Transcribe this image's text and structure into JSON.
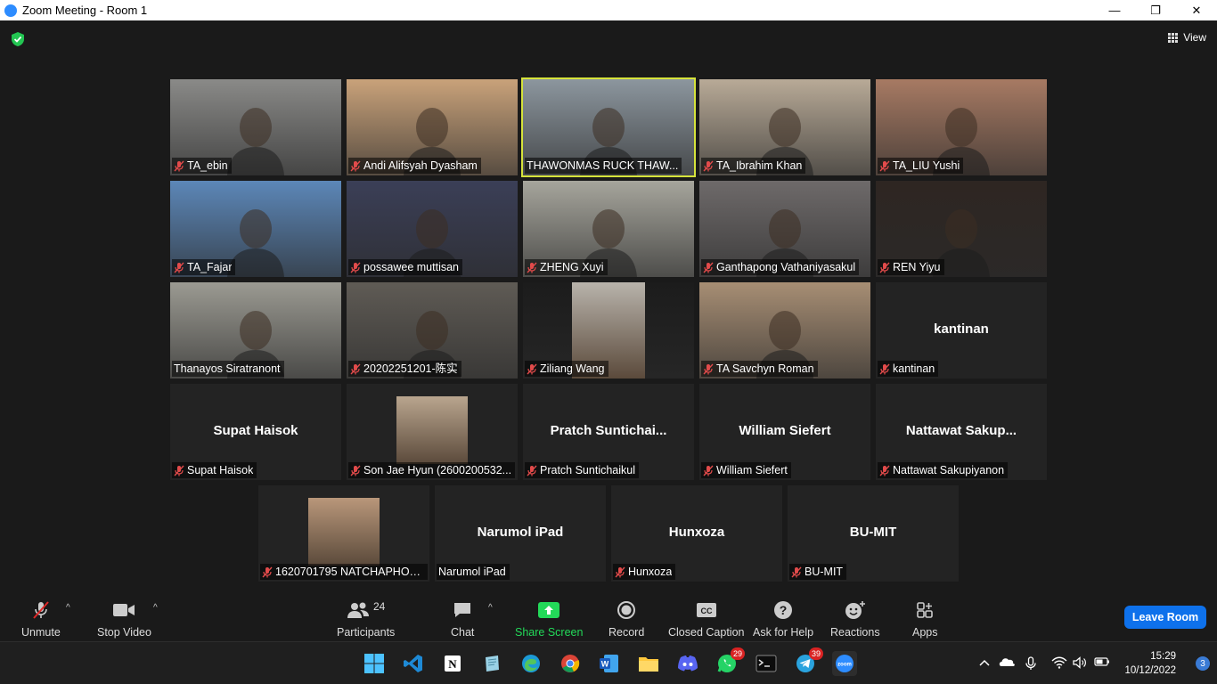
{
  "window": {
    "title": "Zoom Meeting - Room 1",
    "minimize": "—",
    "maximize": "❐",
    "close": "✕"
  },
  "topbar": {
    "view_label": "View"
  },
  "tiles": [
    {
      "name": "TA_ebin",
      "muted": true,
      "bg": "#8a8a88"
    },
    {
      "name": "Andi Alifsyah Dyasham",
      "muted": true,
      "bg": "#c9a27a"
    },
    {
      "name": "THAWONMAS RUCK THAW...",
      "muted": false,
      "bg": "#8c969e",
      "active": true
    },
    {
      "name": "TA_Ibrahim Khan",
      "muted": true,
      "bg": "#b8aa97"
    },
    {
      "name": "TA_LIU Yushi",
      "muted": true,
      "bg": "#a77a63"
    },
    {
      "name": "TA_Fajar",
      "muted": true,
      "bg": "#5c87b8"
    },
    {
      "name": "possawee muttisan",
      "muted": true,
      "bg": "#3b3f57"
    },
    {
      "name": "ZHENG Xuyi",
      "muted": true,
      "bg": "#a6a59c"
    },
    {
      "name": "Ganthapong Vathaniyasakul",
      "muted": true,
      "bg": "#6e6a6a"
    },
    {
      "name": "REN Yiyu",
      "muted": true,
      "bg": "#2e2622"
    },
    {
      "name": "Thanayos Siratranont",
      "muted": false,
      "bg": "#9b9a92"
    },
    {
      "name": "20202251201-陈实",
      "muted": true,
      "bg": "#5f5b55"
    },
    {
      "name": "Ziliang Wang",
      "muted": true,
      "bg": "#1c1c1c",
      "inset": "#b8b3ab"
    },
    {
      "name": "TA Savchyn Roman",
      "muted": true,
      "bg": "#a78e74"
    },
    {
      "name": "kantinan",
      "muted": true,
      "big": "kantinan"
    },
    {
      "name": "Supat Haisok",
      "muted": true,
      "big": "Supat Haisok"
    },
    {
      "name": "Son Jae Hyun (2600200532...",
      "muted": true,
      "inset": "#b9a58e"
    },
    {
      "name": "Pratch Suntichaikul",
      "muted": true,
      "big": "Pratch  Suntichai..."
    },
    {
      "name": "William Siefert",
      "muted": true,
      "big": "William Siefert"
    },
    {
      "name": "Nattawat Sakupiyanon",
      "muted": true,
      "big": "Nattawat  Sakup..."
    },
    {
      "name": "1620701795 NATCHAPHON...",
      "muted": true,
      "inset": "#b9977a"
    },
    {
      "name": "Narumol iPad",
      "muted": false,
      "big": "Narumol iPad"
    },
    {
      "name": "Hunxoza",
      "muted": true,
      "big": "Hunxoza"
    },
    {
      "name": "BU-MIT",
      "muted": true,
      "big": "BU-MIT"
    }
  ],
  "toolbar": {
    "unmute": "Unmute",
    "stop_video": "Stop Video",
    "participants": "Participants",
    "participants_count": "24",
    "chat": "Chat",
    "share_screen": "Share Screen",
    "record": "Record",
    "closed_caption": "Closed Caption",
    "ask_for_help": "Ask for Help",
    "reactions": "Reactions",
    "apps": "Apps",
    "leave_room": "Leave Room",
    "share_color": "#23d959",
    "leave_color": "#0e71eb"
  },
  "taskbar": {
    "whatsapp_badge": "29",
    "telegram_badge": "39",
    "time": "15:29",
    "date": "10/12/2022",
    "notifications": "3"
  }
}
